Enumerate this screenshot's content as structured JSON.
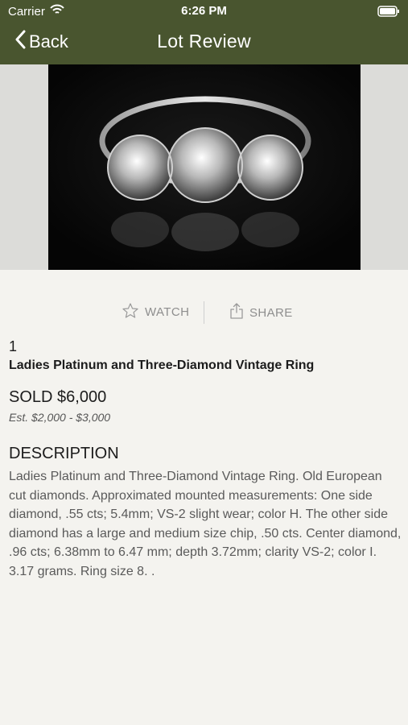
{
  "status_bar": {
    "carrier": "Carrier",
    "time": "6:26 PM"
  },
  "nav": {
    "back_label": "Back",
    "title": "Lot Review"
  },
  "actions": {
    "watch_label": "WATCH",
    "share_label": "SHARE"
  },
  "lot": {
    "number": "1",
    "title": "Ladies Platinum and Three-Diamond Vintage Ring",
    "sold": "SOLD $6,000",
    "estimate": "Est. $2,000 - $3,000"
  },
  "description": {
    "heading": "DESCRIPTION",
    "body": "Ladies Platinum and Three-Diamond Vintage Ring. Old European cut diamonds. Approximated mounted measurements: One side diamond, .55 cts; 5.4mm; VS-2 slight wear; color H. The other side diamond has a large and medium size chip, .50 cts. Center diamond, .96 cts; 6.38mm to 6.47 mm; depth 3.72mm; clarity VS-2; color I. 3.17 grams. Ring size 8. ."
  },
  "colors": {
    "header": "#49552f",
    "background": "#f4f3ef"
  },
  "icons": [
    "wifi-icon",
    "battery-icon",
    "chevron-left-icon",
    "star-icon",
    "share-icon"
  ]
}
